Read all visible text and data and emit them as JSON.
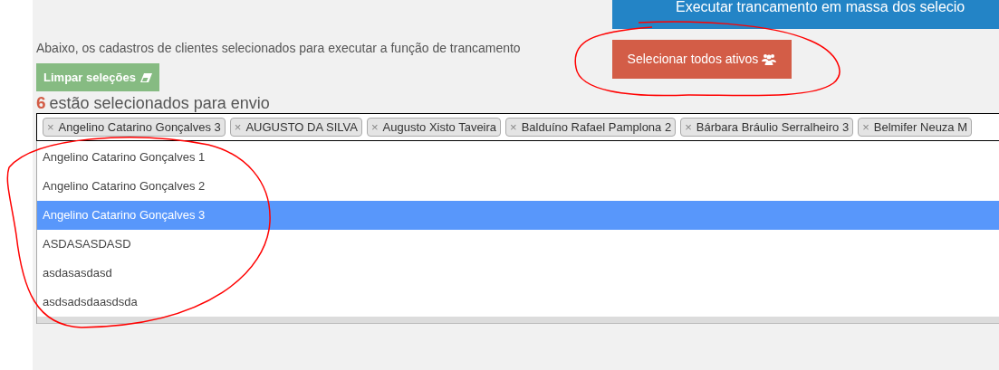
{
  "mass_lock_button": {
    "label": "Executar trancamento em massa dos selecio"
  },
  "description": "Abaixo, os cadastros de clientes selecionados para executar a função de trancamento",
  "clear_button": {
    "label": "Limpar seleções"
  },
  "select_all_button": {
    "label": "Selecionar todos ativos"
  },
  "selected_count": {
    "count": "6",
    "text": "estão selecionados para envio"
  },
  "tags": [
    {
      "remove": "×",
      "label": "Angelino Catarino Gonçalves 3"
    },
    {
      "remove": "×",
      "label": "AUGUSTO DA SILVA"
    },
    {
      "remove": "×",
      "label": "Augusto Xisto Taveira"
    },
    {
      "remove": "×",
      "label": "Balduíno Rafael Pamplona 2"
    },
    {
      "remove": "×",
      "label": "Bárbara Bráulio Serralheiro 3"
    },
    {
      "remove": "×",
      "label": "Belmifer Neuza M"
    }
  ],
  "options": [
    {
      "label": "Angelino Catarino Gonçalves 1",
      "selected": false
    },
    {
      "label": "Angelino Catarino Gonçalves 2",
      "selected": false
    },
    {
      "label": "Angelino Catarino Gonçalves 3",
      "selected": true
    },
    {
      "label": "ASDASASDASD",
      "selected": false
    },
    {
      "label": "asdasasdasd",
      "selected": false
    },
    {
      "label": "asdsadsdaasdsda",
      "selected": false
    }
  ]
}
